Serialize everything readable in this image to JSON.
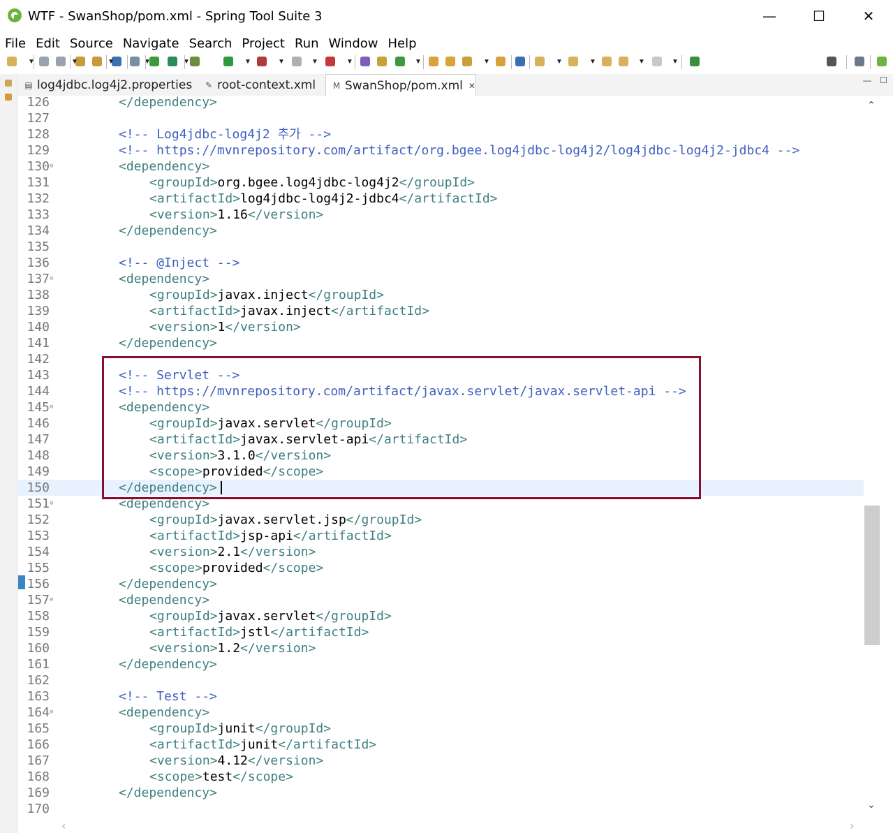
{
  "window": {
    "title": "WTF - SwanShop/pom.xml - Spring Tool Suite 3",
    "minimize": "—",
    "maximize": "☐",
    "close": "✕"
  },
  "menu": [
    "File",
    "Edit",
    "Source",
    "Navigate",
    "Search",
    "Project",
    "Run",
    "Window",
    "Help"
  ],
  "tabs": [
    {
      "label": "log4jdbc.log4j2.properties",
      "icon": "properties-file-icon",
      "active": false
    },
    {
      "label": "root-context.xml",
      "icon": "xml-file-icon",
      "active": false
    },
    {
      "label": "SwanShop/pom.xml",
      "icon": "maven-pom-icon",
      "active": true,
      "close": "✕"
    }
  ],
  "editor": {
    "current_line": "150",
    "lines": [
      {
        "n": "126",
        "fold": false,
        "indent": 2,
        "parts": [
          [
            "tag",
            "</dependency>"
          ]
        ]
      },
      {
        "n": "127",
        "fold": false,
        "indent": 0,
        "parts": []
      },
      {
        "n": "128",
        "fold": false,
        "indent": 2,
        "parts": [
          [
            "cmt",
            "<!-- Log4jdbc-log4j2 추가 -->"
          ]
        ]
      },
      {
        "n": "129",
        "fold": false,
        "indent": 2,
        "parts": [
          [
            "cmt",
            "<!-- https://mvnrepository.com/artifact/org.bgee.log4jdbc-log4j2/log4jdbc-log4j2-jdbc4 -->"
          ]
        ]
      },
      {
        "n": "130",
        "fold": true,
        "indent": 2,
        "parts": [
          [
            "tag",
            "<dependency>"
          ]
        ]
      },
      {
        "n": "131",
        "fold": false,
        "indent": 3,
        "parts": [
          [
            "tag",
            "<groupId>"
          ],
          [
            "txt",
            "org.bgee.log4jdbc-log4j2"
          ],
          [
            "tag",
            "</groupId>"
          ]
        ]
      },
      {
        "n": "132",
        "fold": false,
        "indent": 3,
        "parts": [
          [
            "tag",
            "<artifactId>"
          ],
          [
            "txt",
            "log4jdbc-log4j2-jdbc4"
          ],
          [
            "tag",
            "</artifactId>"
          ]
        ]
      },
      {
        "n": "133",
        "fold": false,
        "indent": 3,
        "parts": [
          [
            "tag",
            "<version>"
          ],
          [
            "txt",
            "1.16"
          ],
          [
            "tag",
            "</version>"
          ]
        ]
      },
      {
        "n": "134",
        "fold": false,
        "indent": 2,
        "parts": [
          [
            "tag",
            "</dependency>"
          ]
        ]
      },
      {
        "n": "135",
        "fold": false,
        "indent": 0,
        "parts": []
      },
      {
        "n": "136",
        "fold": false,
        "indent": 2,
        "parts": [
          [
            "cmt",
            "<!-- @Inject -->"
          ]
        ]
      },
      {
        "n": "137",
        "fold": true,
        "indent": 2,
        "parts": [
          [
            "tag",
            "<dependency>"
          ]
        ]
      },
      {
        "n": "138",
        "fold": false,
        "indent": 3,
        "parts": [
          [
            "tag",
            "<groupId>"
          ],
          [
            "txt",
            "javax.inject"
          ],
          [
            "tag",
            "</groupId>"
          ]
        ]
      },
      {
        "n": "139",
        "fold": false,
        "indent": 3,
        "parts": [
          [
            "tag",
            "<artifactId>"
          ],
          [
            "txt",
            "javax.inject"
          ],
          [
            "tag",
            "</artifactId>"
          ]
        ]
      },
      {
        "n": "140",
        "fold": false,
        "indent": 3,
        "parts": [
          [
            "tag",
            "<version>"
          ],
          [
            "txt",
            "1"
          ],
          [
            "tag",
            "</version>"
          ]
        ]
      },
      {
        "n": "141",
        "fold": false,
        "indent": 2,
        "parts": [
          [
            "tag",
            "</dependency>"
          ]
        ]
      },
      {
        "n": "142",
        "fold": false,
        "indent": 0,
        "parts": []
      },
      {
        "n": "143",
        "fold": false,
        "indent": 2,
        "parts": [
          [
            "cmt",
            "<!-- Servlet -->"
          ]
        ]
      },
      {
        "n": "144",
        "fold": false,
        "indent": 2,
        "parts": [
          [
            "cmt",
            "<!-- https://mvnrepository.com/artifact/javax.servlet/javax.servlet-api -->"
          ]
        ]
      },
      {
        "n": "145",
        "fold": true,
        "indent": 2,
        "parts": [
          [
            "tag",
            "<dependency>"
          ]
        ]
      },
      {
        "n": "146",
        "fold": false,
        "indent": 3,
        "parts": [
          [
            "tag",
            "<groupId>"
          ],
          [
            "txt",
            "javax.servlet"
          ],
          [
            "tag",
            "</groupId>"
          ]
        ]
      },
      {
        "n": "147",
        "fold": false,
        "indent": 3,
        "parts": [
          [
            "tag",
            "<artifactId>"
          ],
          [
            "txt",
            "javax.servlet-api"
          ],
          [
            "tag",
            "</artifactId>"
          ]
        ]
      },
      {
        "n": "148",
        "fold": false,
        "indent": 3,
        "parts": [
          [
            "tag",
            "<version>"
          ],
          [
            "txt",
            "3.1.0"
          ],
          [
            "tag",
            "</version>"
          ]
        ]
      },
      {
        "n": "149",
        "fold": false,
        "indent": 3,
        "parts": [
          [
            "tag",
            "<scope>"
          ],
          [
            "txt",
            "provided"
          ],
          [
            "tag",
            "</scope>"
          ]
        ]
      },
      {
        "n": "150",
        "fold": false,
        "indent": 2,
        "parts": [
          [
            "tag",
            "</dependency>"
          ]
        ]
      },
      {
        "n": "151",
        "fold": true,
        "indent": 2,
        "parts": [
          [
            "tag",
            "<dependency>"
          ]
        ]
      },
      {
        "n": "152",
        "fold": false,
        "indent": 3,
        "parts": [
          [
            "tag",
            "<groupId>"
          ],
          [
            "txt",
            "javax.servlet.jsp"
          ],
          [
            "tag",
            "</groupId>"
          ]
        ]
      },
      {
        "n": "153",
        "fold": false,
        "indent": 3,
        "parts": [
          [
            "tag",
            "<artifactId>"
          ],
          [
            "txt",
            "jsp-api"
          ],
          [
            "tag",
            "</artifactId>"
          ]
        ]
      },
      {
        "n": "154",
        "fold": false,
        "indent": 3,
        "parts": [
          [
            "tag",
            "<version>"
          ],
          [
            "txt",
            "2.1"
          ],
          [
            "tag",
            "</version>"
          ]
        ]
      },
      {
        "n": "155",
        "fold": false,
        "indent": 3,
        "parts": [
          [
            "tag",
            "<scope>"
          ],
          [
            "txt",
            "provided"
          ],
          [
            "tag",
            "</scope>"
          ]
        ]
      },
      {
        "n": "156",
        "fold": false,
        "indent": 2,
        "parts": [
          [
            "tag",
            "</dependency>"
          ]
        ]
      },
      {
        "n": "157",
        "fold": true,
        "indent": 2,
        "parts": [
          [
            "tag",
            "<dependency>"
          ]
        ]
      },
      {
        "n": "158",
        "fold": false,
        "indent": 3,
        "parts": [
          [
            "tag",
            "<groupId>"
          ],
          [
            "txt",
            "javax.servlet"
          ],
          [
            "tag",
            "</groupId>"
          ]
        ]
      },
      {
        "n": "159",
        "fold": false,
        "indent": 3,
        "parts": [
          [
            "tag",
            "<artifactId>"
          ],
          [
            "txt",
            "jstl"
          ],
          [
            "tag",
            "</artifactId>"
          ]
        ]
      },
      {
        "n": "160",
        "fold": false,
        "indent": 3,
        "parts": [
          [
            "tag",
            "<version>"
          ],
          [
            "txt",
            "1.2"
          ],
          [
            "tag",
            "</version>"
          ]
        ]
      },
      {
        "n": "161",
        "fold": false,
        "indent": 2,
        "parts": [
          [
            "tag",
            "</dependency>"
          ]
        ]
      },
      {
        "n": "162",
        "fold": false,
        "indent": 0,
        "parts": []
      },
      {
        "n": "163",
        "fold": false,
        "indent": 2,
        "parts": [
          [
            "cmt",
            "<!-- Test -->"
          ]
        ]
      },
      {
        "n": "164",
        "fold": true,
        "indent": 2,
        "parts": [
          [
            "tag",
            "<dependency>"
          ]
        ]
      },
      {
        "n": "165",
        "fold": false,
        "indent": 3,
        "parts": [
          [
            "tag",
            "<groupId>"
          ],
          [
            "txt",
            "junit"
          ],
          [
            "tag",
            "</groupId>"
          ]
        ]
      },
      {
        "n": "166",
        "fold": false,
        "indent": 3,
        "parts": [
          [
            "tag",
            "<artifactId>"
          ],
          [
            "txt",
            "junit"
          ],
          [
            "tag",
            "</artifactId>"
          ]
        ]
      },
      {
        "n": "167",
        "fold": false,
        "indent": 3,
        "parts": [
          [
            "tag",
            "<version>"
          ],
          [
            "txt",
            "4.12"
          ],
          [
            "tag",
            "</version>"
          ]
        ]
      },
      {
        "n": "168",
        "fold": false,
        "indent": 3,
        "parts": [
          [
            "tag",
            "<scope>"
          ],
          [
            "txt",
            "test"
          ],
          [
            "tag",
            "</scope>"
          ]
        ]
      },
      {
        "n": "169",
        "fold": false,
        "indent": 2,
        "parts": [
          [
            "tag",
            "</dependency>"
          ]
        ]
      },
      {
        "n": "170",
        "fold": false,
        "indent": 0,
        "parts": []
      }
    ]
  },
  "colors": {
    "tag": "#3f7f7f",
    "comment": "#3f5fbf",
    "text": "#000000",
    "highlight_box": "#8a0f2e",
    "current_line": "#e8f2fe"
  },
  "scroll": {
    "up_arrow": "⌃",
    "down_arrow": "⌄",
    "left_arrow": "‹",
    "right_arrow": "›"
  }
}
